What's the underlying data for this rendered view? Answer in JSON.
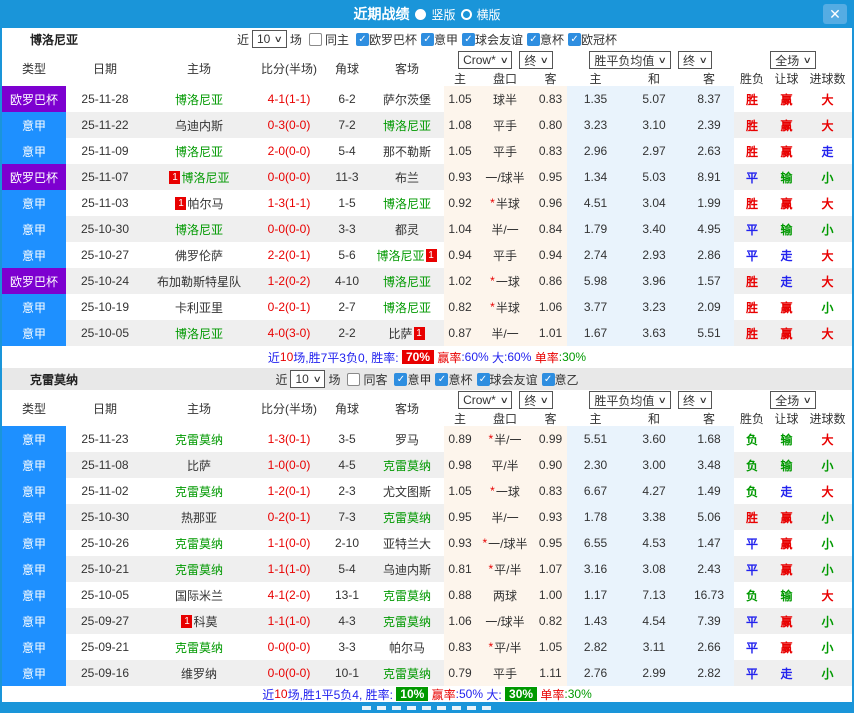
{
  "titlebar": {
    "title": "近期战绩",
    "vertical": "竖版",
    "horizontal": "横版",
    "close_icon": "✕"
  },
  "colors": {
    "league": {
      "意甲": "#1e90ff",
      "欧罗巴杯": "#7d00d0"
    },
    "result": {
      "胜": "#e80000",
      "赢": "#e80000",
      "大": "#e80000",
      "平": "#2222ee",
      "走": "#2222ee",
      "负": "#009900",
      "输": "#009900",
      "小": "#009900"
    }
  },
  "header": {
    "type": "类型",
    "date": "日期",
    "home": "主场",
    "score": "比分(半场)",
    "corner": "角球",
    "away": "客场",
    "crow_select": "Crow*",
    "end_select": "终",
    "crow_home": "主",
    "crow_pan": "盘口",
    "crow_away": "客",
    "avg_select": "胜平负均值",
    "avg_home": "主",
    "avg_draw": "和",
    "avg_away": "客",
    "full_select": "全场",
    "res_wdl": "胜负",
    "res_handicap": "让球",
    "res_goals": "进球数"
  },
  "sections": [
    {
      "team": "博洛尼亚",
      "filter": {
        "near": "近",
        "n": "10",
        "chang": "场",
        "same": "同主",
        "same_checked": false,
        "leagues": [
          {
            "label": "欧罗巴杯",
            "checked": true
          },
          {
            "label": "意甲",
            "checked": true
          },
          {
            "label": "球会友谊",
            "checked": true
          },
          {
            "label": "意杯",
            "checked": true
          },
          {
            "label": "欧冠杯",
            "checked": true
          }
        ]
      },
      "rows": [
        {
          "lg": "欧罗巴杯",
          "d": "25-11-28",
          "h": "博洛尼亚",
          "hg": 1,
          "hb": "",
          "s": "4-1(1-1)",
          "cn": "6-2",
          "a": "萨尔茨堡",
          "ag": 0,
          "ab": "",
          "c1": "1.05",
          "st": 0,
          "pk": "球半",
          "c3": "0.83",
          "m1": "1.35",
          "m2": "5.07",
          "m3": "8.37",
          "r1": "胜",
          "r2": "赢",
          "r3": "大"
        },
        {
          "lg": "意甲",
          "d": "25-11-22",
          "h": "乌迪内斯",
          "hg": 0,
          "hb": "",
          "s": "0-3(0-0)",
          "cn": "7-2",
          "a": "博洛尼亚",
          "ag": 1,
          "ab": "",
          "c1": "1.08",
          "st": 0,
          "pk": "平手",
          "c3": "0.80",
          "m1": "3.23",
          "m2": "3.10",
          "m3": "2.39",
          "r1": "胜",
          "r2": "赢",
          "r3": "大"
        },
        {
          "lg": "意甲",
          "d": "25-11-09",
          "h": "博洛尼亚",
          "hg": 1,
          "hb": "",
          "s": "2-0(0-0)",
          "cn": "5-4",
          "a": "那不勒斯",
          "ag": 0,
          "ab": "",
          "c1": "1.05",
          "st": 0,
          "pk": "平手",
          "c3": "0.83",
          "m1": "2.96",
          "m2": "2.97",
          "m3": "2.63",
          "r1": "胜",
          "r2": "赢",
          "r3": "走"
        },
        {
          "lg": "欧罗巴杯",
          "d": "25-11-07",
          "h": "博洛尼亚",
          "hg": 1,
          "hb": "1",
          "s": "0-0(0-0)",
          "cn": "11-3",
          "a": "布兰",
          "ag": 0,
          "ab": "",
          "c1": "0.93",
          "st": 0,
          "pk": "一/球半",
          "c3": "0.95",
          "m1": "1.34",
          "m2": "5.03",
          "m3": "8.91",
          "r1": "平",
          "r2": "输",
          "r3": "小"
        },
        {
          "lg": "意甲",
          "d": "25-11-03",
          "h": "帕尔马",
          "hg": 0,
          "hb": "1",
          "s": "1-3(1-1)",
          "cn": "1-5",
          "a": "博洛尼亚",
          "ag": 1,
          "ab": "",
          "c1": "0.92",
          "st": 1,
          "pk": "半球",
          "c3": "0.96",
          "m1": "4.51",
          "m2": "3.04",
          "m3": "1.99",
          "r1": "胜",
          "r2": "赢",
          "r3": "大"
        },
        {
          "lg": "意甲",
          "d": "25-10-30",
          "h": "博洛尼亚",
          "hg": 1,
          "hb": "",
          "s": "0-0(0-0)",
          "cn": "3-3",
          "a": "都灵",
          "ag": 0,
          "ab": "",
          "c1": "1.04",
          "st": 0,
          "pk": "半/一",
          "c3": "0.84",
          "m1": "1.79",
          "m2": "3.40",
          "m3": "4.95",
          "r1": "平",
          "r2": "输",
          "r3": "小"
        },
        {
          "lg": "意甲",
          "d": "25-10-27",
          "h": "佛罗伦萨",
          "hg": 0,
          "hb": "",
          "s": "2-2(0-1)",
          "cn": "5-6",
          "a": "博洛尼亚",
          "ag": 1,
          "ab": "1",
          "c1": "0.94",
          "st": 0,
          "pk": "平手",
          "c3": "0.94",
          "m1": "2.74",
          "m2": "2.93",
          "m3": "2.86",
          "r1": "平",
          "r2": "走",
          "r3": "大"
        },
        {
          "lg": "欧罗巴杯",
          "d": "25-10-24",
          "h": "布加勒斯特星队",
          "hg": 0,
          "hb": "",
          "s": "1-2(0-2)",
          "cn": "4-10",
          "a": "博洛尼亚",
          "ag": 1,
          "ab": "",
          "c1": "1.02",
          "st": 1,
          "pk": "一球",
          "c3": "0.86",
          "m1": "5.98",
          "m2": "3.96",
          "m3": "1.57",
          "r1": "胜",
          "r2": "走",
          "r3": "大"
        },
        {
          "lg": "意甲",
          "d": "25-10-19",
          "h": "卡利亚里",
          "hg": 0,
          "hb": "",
          "s": "0-2(0-1)",
          "cn": "2-7",
          "a": "博洛尼亚",
          "ag": 1,
          "ab": "",
          "c1": "0.82",
          "st": 1,
          "pk": "半球",
          "c3": "1.06",
          "m1": "3.77",
          "m2": "3.23",
          "m3": "2.09",
          "r1": "胜",
          "r2": "赢",
          "r3": "小"
        },
        {
          "lg": "意甲",
          "d": "25-10-05",
          "h": "博洛尼亚",
          "hg": 1,
          "hb": "",
          "s": "4-0(3-0)",
          "cn": "2-2",
          "a": "比萨",
          "ag": 0,
          "ab": "1",
          "c1": "0.87",
          "st": 0,
          "pk": "半/一",
          "c3": "1.01",
          "m1": "1.67",
          "m2": "3.63",
          "m3": "5.51",
          "r1": "胜",
          "r2": "赢",
          "r3": "大"
        }
      ],
      "summary": [
        {
          "t": "近",
          "c": "#2222ee"
        },
        {
          "t": "10",
          "c": "#e80000"
        },
        {
          "t": "场,胜7平3负0, 胜率: ",
          "c": "#2222ee"
        },
        {
          "t": "70%",
          "c": "#ffffff",
          "bg": "#e80000"
        },
        {
          "t": " 赢率",
          "c": "#e80000"
        },
        {
          "t": ":60%",
          "c": "#2222ee"
        },
        {
          "t": " 大",
          "c": "#2222ee"
        },
        {
          "t": ":60%",
          "c": "#2222ee"
        },
        {
          "t": " 单率",
          "c": "#e80000"
        },
        {
          "t": ":30%",
          "c": "#009900"
        }
      ]
    },
    {
      "team": "克雷莫纳",
      "filter": {
        "near": "近",
        "n": "10",
        "chang": "场",
        "same": "同客",
        "same_checked": false,
        "leagues": [
          {
            "label": "意甲",
            "checked": true
          },
          {
            "label": "意杯",
            "checked": true
          },
          {
            "label": "球会友谊",
            "checked": true
          },
          {
            "label": "意乙",
            "checked": true
          }
        ]
      },
      "rows": [
        {
          "lg": "意甲",
          "d": "25-11-23",
          "h": "克雷莫纳",
          "hg": 1,
          "hb": "",
          "s": "1-3(0-1)",
          "cn": "3-5",
          "a": "罗马",
          "ag": 0,
          "ab": "",
          "c1": "0.89",
          "st": 1,
          "pk": "半/一",
          "c3": "0.99",
          "m1": "5.51",
          "m2": "3.60",
          "m3": "1.68",
          "r1": "负",
          "r2": "输",
          "r3": "大"
        },
        {
          "lg": "意甲",
          "d": "25-11-08",
          "h": "比萨",
          "hg": 0,
          "hb": "",
          "s": "1-0(0-0)",
          "cn": "4-5",
          "a": "克雷莫纳",
          "ag": 1,
          "ab": "",
          "c1": "0.98",
          "st": 0,
          "pk": "平/半",
          "c3": "0.90",
          "m1": "2.30",
          "m2": "3.00",
          "m3": "3.48",
          "r1": "负",
          "r2": "输",
          "r3": "小"
        },
        {
          "lg": "意甲",
          "d": "25-11-02",
          "h": "克雷莫纳",
          "hg": 1,
          "hb": "",
          "s": "1-2(0-1)",
          "cn": "2-3",
          "a": "尤文图斯",
          "ag": 0,
          "ab": "",
          "c1": "1.05",
          "st": 1,
          "pk": "一球",
          "c3": "0.83",
          "m1": "6.67",
          "m2": "4.27",
          "m3": "1.49",
          "r1": "负",
          "r2": "走",
          "r3": "大"
        },
        {
          "lg": "意甲",
          "d": "25-10-30",
          "h": "热那亚",
          "hg": 0,
          "hb": "",
          "s": "0-2(0-1)",
          "cn": "7-3",
          "a": "克雷莫纳",
          "ag": 1,
          "ab": "",
          "c1": "0.95",
          "st": 0,
          "pk": "半/一",
          "c3": "0.93",
          "m1": "1.78",
          "m2": "3.38",
          "m3": "5.06",
          "r1": "胜",
          "r2": "赢",
          "r3": "小"
        },
        {
          "lg": "意甲",
          "d": "25-10-26",
          "h": "克雷莫纳",
          "hg": 1,
          "hb": "",
          "s": "1-1(0-0)",
          "cn": "2-10",
          "a": "亚特兰大",
          "ag": 0,
          "ab": "",
          "c1": "0.93",
          "st": 1,
          "pk": "一/球半",
          "c3": "0.95",
          "m1": "6.55",
          "m2": "4.53",
          "m3": "1.47",
          "r1": "平",
          "r2": "赢",
          "r3": "小"
        },
        {
          "lg": "意甲",
          "d": "25-10-21",
          "h": "克雷莫纳",
          "hg": 1,
          "hb": "",
          "s": "1-1(1-0)",
          "cn": "5-4",
          "a": "乌迪内斯",
          "ag": 0,
          "ab": "",
          "c1": "0.81",
          "st": 1,
          "pk": "平/半",
          "c3": "1.07",
          "m1": "3.16",
          "m2": "3.08",
          "m3": "2.43",
          "r1": "平",
          "r2": "赢",
          "r3": "小"
        },
        {
          "lg": "意甲",
          "d": "25-10-05",
          "h": "国际米兰",
          "hg": 0,
          "hb": "",
          "s": "4-1(2-0)",
          "cn": "13-1",
          "a": "克雷莫纳",
          "ag": 1,
          "ab": "",
          "c1": "0.88",
          "st": 0,
          "pk": "两球",
          "c3": "1.00",
          "m1": "1.17",
          "m2": "7.13",
          "m3": "16.73",
          "r1": "负",
          "r2": "输",
          "r3": "大"
        },
        {
          "lg": "意甲",
          "d": "25-09-27",
          "h": "科莫",
          "hg": 0,
          "hb": "1",
          "s": "1-1(1-0)",
          "cn": "4-3",
          "a": "克雷莫纳",
          "ag": 1,
          "ab": "",
          "c1": "1.06",
          "st": 0,
          "pk": "一/球半",
          "c3": "0.82",
          "m1": "1.43",
          "m2": "4.54",
          "m3": "7.39",
          "r1": "平",
          "r2": "赢",
          "r3": "小"
        },
        {
          "lg": "意甲",
          "d": "25-09-21",
          "h": "克雷莫纳",
          "hg": 1,
          "hb": "",
          "s": "0-0(0-0)",
          "cn": "3-3",
          "a": "帕尔马",
          "ag": 0,
          "ab": "",
          "c1": "0.83",
          "st": 1,
          "pk": "平/半",
          "c3": "1.05",
          "m1": "2.82",
          "m2": "3.11",
          "m3": "2.66",
          "r1": "平",
          "r2": "赢",
          "r3": "小"
        },
        {
          "lg": "意甲",
          "d": "25-09-16",
          "h": "维罗纳",
          "hg": 0,
          "hb": "",
          "s": "0-0(0-0)",
          "cn": "10-1",
          "a": "克雷莫纳",
          "ag": 1,
          "ab": "",
          "c1": "0.79",
          "st": 0,
          "pk": "平手",
          "c3": "1.11",
          "m1": "2.76",
          "m2": "2.99",
          "m3": "2.82",
          "r1": "平",
          "r2": "走",
          "r3": "小"
        }
      ],
      "summary": [
        {
          "t": "近",
          "c": "#2222ee"
        },
        {
          "t": "10",
          "c": "#e80000"
        },
        {
          "t": "场,胜1平5负4, 胜率: ",
          "c": "#2222ee"
        },
        {
          "t": "10%",
          "c": "#ffffff",
          "bg": "#009900"
        },
        {
          "t": " 赢率",
          "c": "#e80000"
        },
        {
          "t": ":50%",
          "c": "#2222ee"
        },
        {
          "t": " 大: ",
          "c": "#2222ee"
        },
        {
          "t": "30%",
          "c": "#ffffff",
          "bg": "#009900"
        },
        {
          "t": " 单率",
          "c": "#e80000"
        },
        {
          "t": ":30%",
          "c": "#009900"
        }
      ]
    }
  ]
}
